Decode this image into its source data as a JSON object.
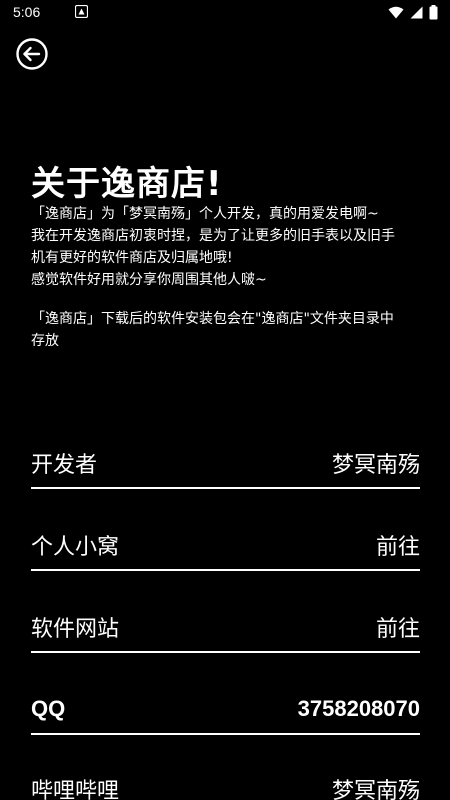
{
  "status_bar": {
    "time": "5:06",
    "icons": [
      "notification-icon",
      "wifi-icon",
      "signal-icon",
      "battery-icon"
    ]
  },
  "header": {
    "back_icon": "back-arrow-icon"
  },
  "title": "关于逸商店!",
  "intro_lines": [
    "「逸商店」为「梦冥南殇」个人开发，真的用爱发电啊~",
    "我在开发逸商店初衷时捏，是为了让更多的旧手表以及旧手",
    "机有更好的软件商店及归属地哦!",
    "感觉软件好用就分享你周围其他人啵~"
  ],
  "note_lines": [
    "「逸商店」下载后的软件安装包会在\"逸商店\"文件夹目录中",
    "存放"
  ],
  "rows": [
    {
      "label": "开发者",
      "value": "梦冥南殇"
    },
    {
      "label": "个人小窝",
      "value": "前往"
    },
    {
      "label": "软件网站",
      "value": "前往"
    },
    {
      "label": "QQ",
      "value": "3758208070"
    },
    {
      "label": "哔哩哔哩",
      "value": "梦冥南殇"
    }
  ],
  "colors": {
    "background": "#000000",
    "foreground": "#ffffff"
  }
}
